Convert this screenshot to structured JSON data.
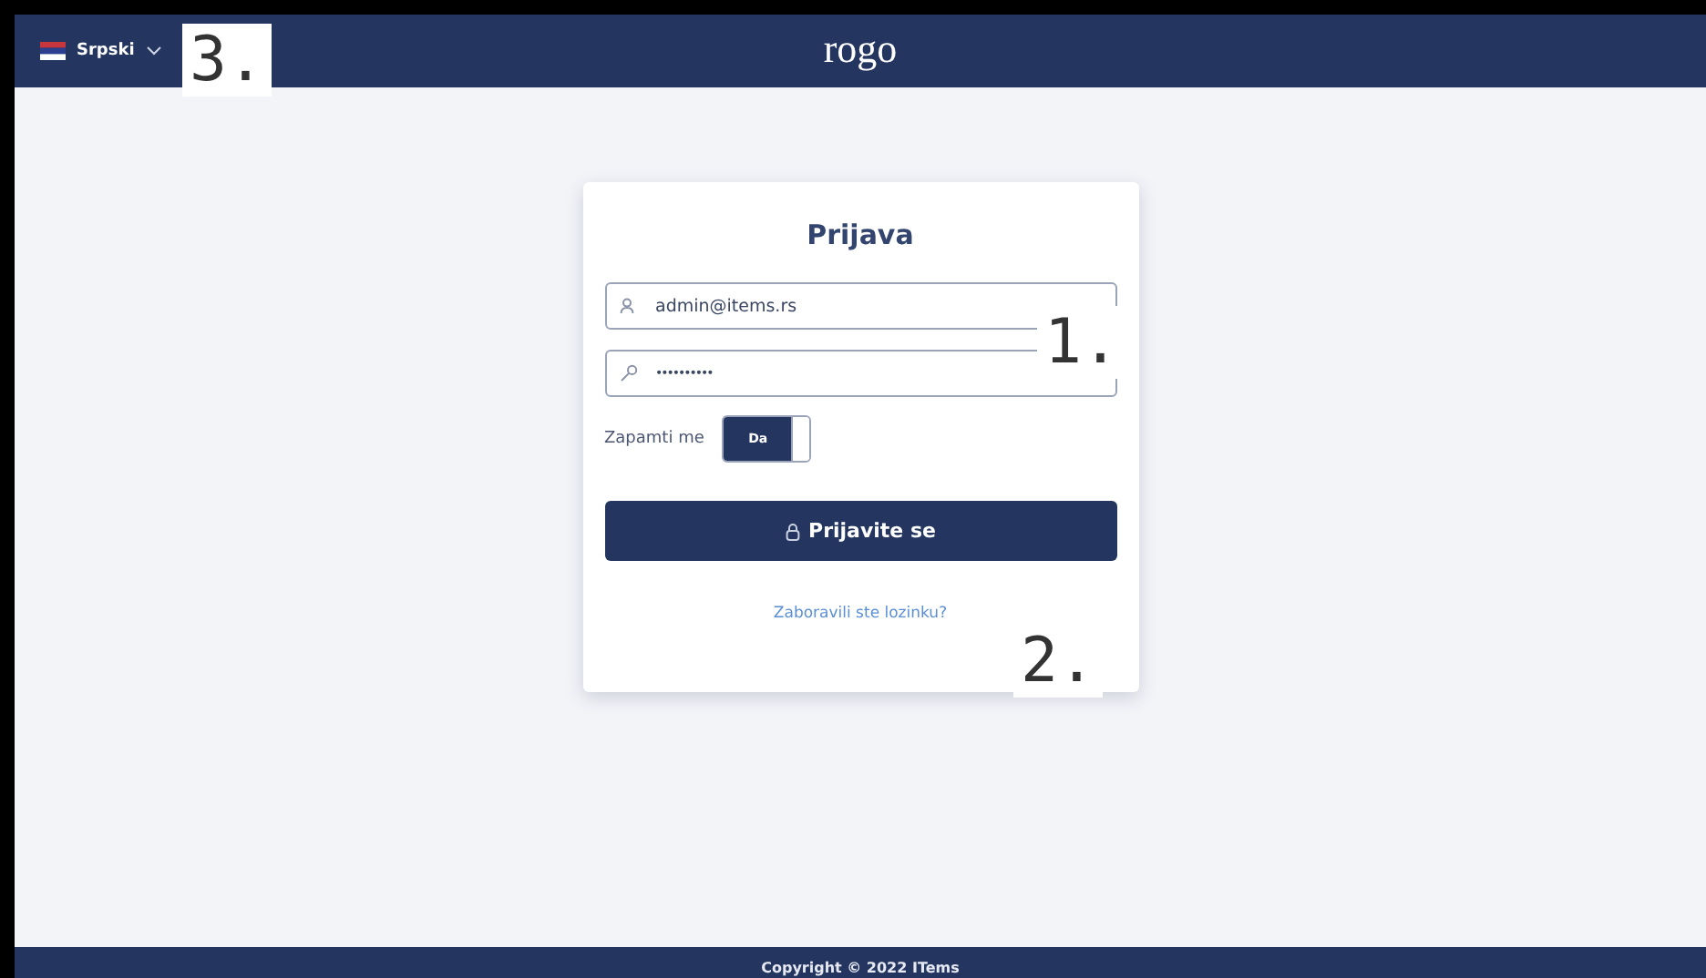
{
  "header": {
    "language": "Srpski",
    "logo": "rogo"
  },
  "login": {
    "title": "Prijava",
    "email": {
      "value": "admin@items.rs"
    },
    "password": {
      "value": "••••••••••"
    },
    "remember": {
      "label": "Zapamti me",
      "toggle_text": "Da",
      "on": true
    },
    "submit": "Prijavite se",
    "forgot_link": "Zaboravili ste lozinku?"
  },
  "callouts": [
    {
      "label": "1."
    },
    {
      "label": "2."
    },
    {
      "label": "3."
    }
  ],
  "footer": {
    "text": "Copyright © 2022 ITems"
  }
}
